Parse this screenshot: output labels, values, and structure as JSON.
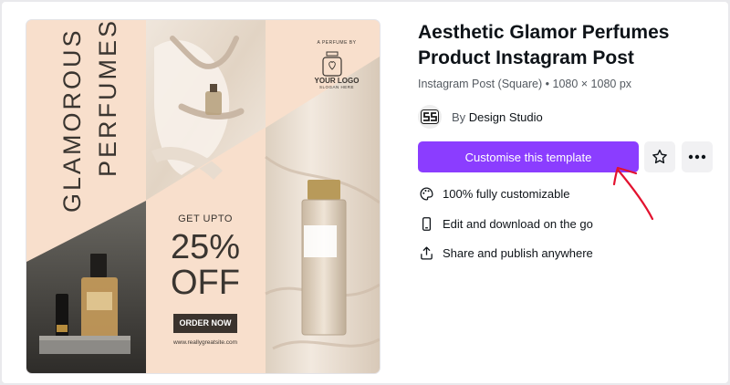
{
  "template": {
    "title": "Aesthetic Glamor Perfumes Product Instagram Post",
    "meta": "Instagram Post (Square) • 1080 × 1080 px",
    "author_prefix": "By",
    "author_name": "Design Studio",
    "cta_label": "Customise this template"
  },
  "features": [
    {
      "icon": "palette-icon",
      "label": "100% fully customizable"
    },
    {
      "icon": "phone-icon",
      "label": "Edit and download on the go"
    },
    {
      "icon": "share-icon",
      "label": "Share and publish anywhere"
    }
  ],
  "preview": {
    "headline_line1": "GLAMOROUS",
    "headline_line2": "PERFUMES",
    "logo_kicker": "A PERFUME BY",
    "logo_name": "YOUR LOGO",
    "logo_slogan": "SLOGAN HERE",
    "offer_kicker": "GET UPTO",
    "offer_percent": "25%",
    "offer_off": "OFF",
    "order_button": "ORDER NOW",
    "website": "www.reallygreatsite.com"
  },
  "colors": {
    "accent": "#8b3dff",
    "annotation_arrow": "#e3122f",
    "preview_bg": "#f8dfcc"
  }
}
